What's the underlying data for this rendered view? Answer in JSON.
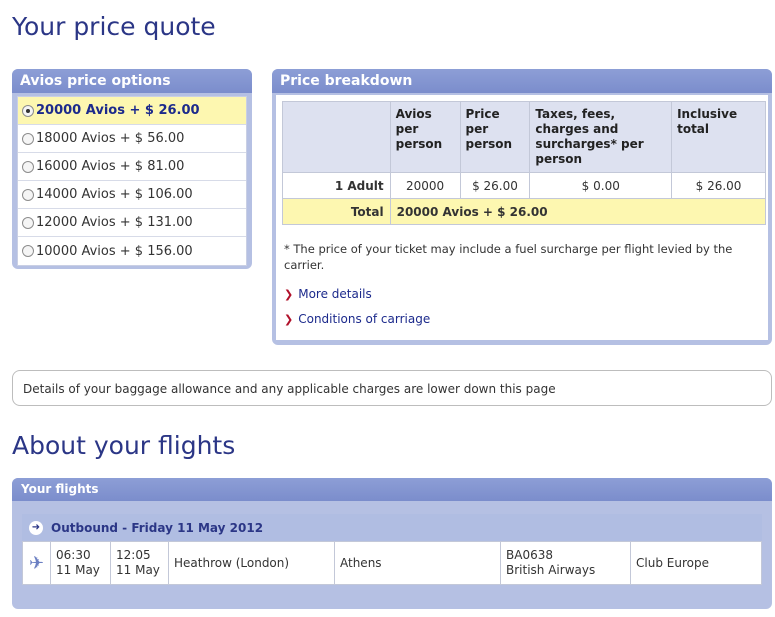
{
  "page": {
    "title": "Your price quote",
    "about_title": "About your flights"
  },
  "avios": {
    "header": "Avios price options",
    "options": [
      {
        "label": "20000 Avios + $ 26.00",
        "selected": true
      },
      {
        "label": "18000 Avios + $ 56.00",
        "selected": false
      },
      {
        "label": "16000 Avios + $ 81.00",
        "selected": false
      },
      {
        "label": "14000 Avios + $ 106.00",
        "selected": false
      },
      {
        "label": "12000 Avios + $ 131.00",
        "selected": false
      },
      {
        "label": "10000 Avios + $ 156.00",
        "selected": false
      }
    ]
  },
  "price": {
    "header": "Price breakdown",
    "columns": [
      "Avios per person",
      "Price per person",
      "Taxes, fees, charges and surcharges* per person",
      "Inclusive total"
    ],
    "row": {
      "label": "1 Adult",
      "avios": "20000",
      "price": "$ 26.00",
      "taxes": "$ 0.00",
      "total": "$ 26.00"
    },
    "total": {
      "label": "Total",
      "value": "20000 Avios + $ 26.00"
    },
    "note": "* The price of your ticket may include a fuel surcharge per flight levied by the carrier.",
    "links": {
      "more": "More details",
      "conditions": "Conditions of carriage"
    }
  },
  "baggage": {
    "text": "Details of your baggage allowance and any applicable charges are lower down this page"
  },
  "flights": {
    "header": "Your flights",
    "outbound": "Outbound - Friday 11 May 2012",
    "segment": {
      "depart_time": "06:30",
      "depart_date": "11 May",
      "arrive_time": "12:05",
      "arrive_date": "11 May",
      "from": "Heathrow (London)",
      "to": "Athens",
      "flight_no": "BA0638",
      "carrier": "British Airways",
      "cabin": "Club Europe"
    }
  },
  "colors": {
    "heading": "#2b3686",
    "panel": "#b5c0e3",
    "panel_header": "#8d9ed6",
    "highlight": "#fdf7b0",
    "link_chevron": "#b0102a"
  },
  "icons": {
    "radio": "radio-button",
    "link": "chevron-right-icon",
    "outbound": "arrow-right-circle-icon",
    "flight": "plane-icon"
  }
}
